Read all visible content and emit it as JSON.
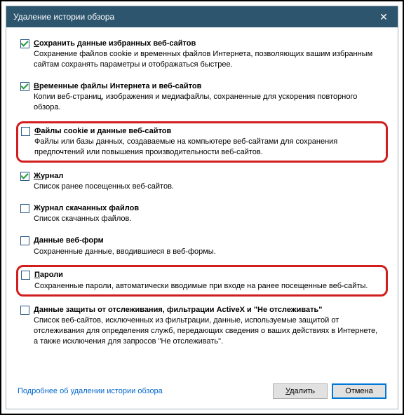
{
  "titlebar": {
    "title": "Удаление истории обзора",
    "close_glyph": "✕"
  },
  "options": [
    {
      "label": "Сохранить данные избранных веб-сайтов",
      "desc": "Сохранение файлов cookie и временных файлов Интернета, позволяющих вашим избранным сайтам сохранять параметры и отображаться быстрее."
    },
    {
      "label": "Временные файлы Интернета и веб-сайтов",
      "desc": "Копии веб-страниц, изображения и медиафайлы, сохраненные для ускорения повторного обзора."
    },
    {
      "label": "Файлы cookie и данные веб-сайтов",
      "desc": "Файлы или базы данных, создаваемые на компьютере веб-сайтами для сохранения предпочтений или повышения производительности веб-сайтов."
    },
    {
      "label": "Журнал",
      "desc": "Список ранее посещенных веб-сайтов."
    },
    {
      "label": "Журнал скачанных файлов",
      "desc": "Список скачанных файлов."
    },
    {
      "label": "Данные веб-форм",
      "desc": "Сохраненные данные, вводившиеся в веб-формы."
    },
    {
      "label": "Пароли",
      "desc": "Сохраненные пароли, автоматически вводимые при входе на ранее посещенные веб-сайты."
    },
    {
      "label": "Данные защиты от отслеживания, фильтрации ActiveX и \"Не отслеживать\"",
      "desc": "Список веб-сайтов, исключенных из фильтрации, данные, используемые защитой от отслеживания для определения служб, передающих сведения о ваших действиях в Интернете, а также исключения для запросов \"Не отслеживать\"."
    }
  ],
  "footer": {
    "learn_more": "Подробнее об удалении истории обзора",
    "delete_btn": "Удалить",
    "cancel_btn": "Отмена"
  }
}
